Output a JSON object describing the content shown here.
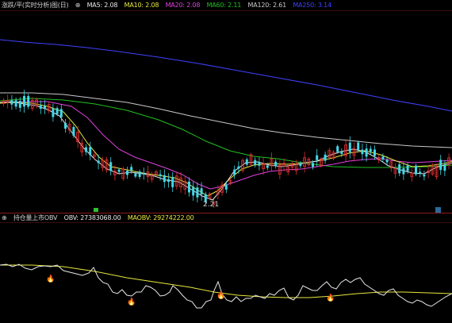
{
  "main_panel": {
    "title": "涨跌/平(实时分析)图(日)",
    "indicators": [
      {
        "label": "MA5: 2.08",
        "color": "#e8e8e8"
      },
      {
        "label": "MA10: 2.08",
        "color": "#e8e840"
      },
      {
        "label": "MA20: 2.08",
        "color": "#e040e0"
      },
      {
        "label": "MA60: 2.11",
        "color": "#20c020"
      },
      {
        "label": "MA120: 2.61",
        "color": "#c8c8c8"
      },
      {
        "label": "MA250: 3.14",
        "color": "#4040ff"
      }
    ],
    "low_price_label": "2.21"
  },
  "sub_panel": {
    "title": "持仓量上市OBV",
    "obv_label": "OBV: 27383068.00",
    "maobv_label": "MAOBV: 29274222.00",
    "colors": {
      "obv": "#e8e8e8",
      "maobv": "#e8e840",
      "title": "#d0d0d0"
    }
  },
  "colors": {
    "up": "#e03030",
    "down": "#40d8e8",
    "background": "#000000",
    "divider": "#8a1a1a",
    "flame": "#ff9020"
  },
  "icons": [
    "settings-icon",
    "flame-icon",
    "green-marker-icon",
    "scroll-marker-icon"
  ]
}
